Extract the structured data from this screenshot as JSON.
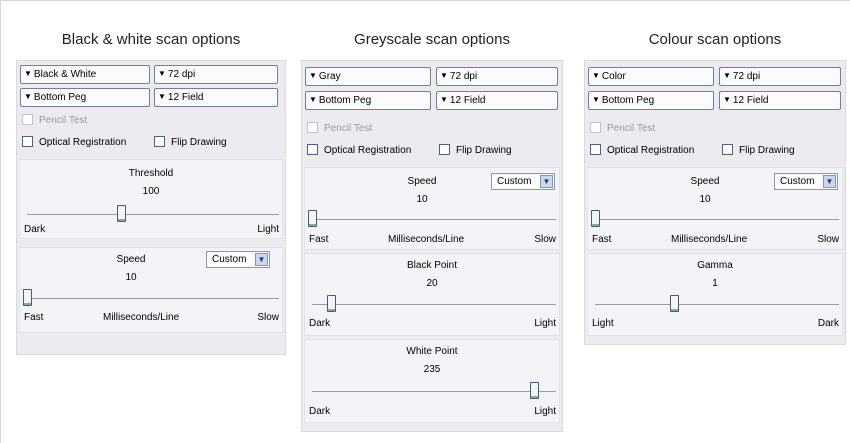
{
  "columns": {
    "bw": {
      "title": "Black & white scan options",
      "mode": "Black & White",
      "resolution": "72 dpi",
      "peg": "Bottom Peg",
      "field": "12 Field",
      "pencil_test": "Pencil Test",
      "optical_registration": "Optical Registration",
      "flip_drawing": "Flip Drawing",
      "threshold": {
        "label": "Threshold",
        "value": "100",
        "low": "Dark",
        "high": "Light",
        "level": 0.41
      },
      "speed": {
        "label": "Speed",
        "value": "10",
        "preset": "Custom",
        "low": "Fast",
        "mid": "Milliseconds/Line",
        "high": "Slow",
        "level": 0.0
      }
    },
    "grey": {
      "title": "Greyscale scan options",
      "mode": "Gray",
      "resolution": "72 dpi",
      "peg": "Bottom Peg",
      "field": "12 Field",
      "pencil_test": "Pencil Test",
      "optical_registration": "Optical Registration",
      "flip_drawing": "Flip Drawing",
      "speed": {
        "label": "Speed",
        "value": "10",
        "preset": "Custom",
        "low": "Fast",
        "mid": "Milliseconds/Line",
        "high": "Slow",
        "level": 0.0
      },
      "black_point": {
        "label": "Black Point",
        "value": "20",
        "low": "Dark",
        "high": "Light",
        "level": 0.08
      },
      "white_point": {
        "label": "White Point",
        "value": "235",
        "low": "Dark",
        "high": "Light",
        "level": 0.92
      }
    },
    "colour": {
      "title": "Colour scan options",
      "mode": "Color",
      "resolution": "72 dpi",
      "peg": "Bottom Peg",
      "field": "12 Field",
      "pencil_test": "Pencil Test",
      "optical_registration": "Optical Registration",
      "flip_drawing": "Flip Drawing",
      "speed": {
        "label": "Speed",
        "value": "10",
        "preset": "Custom",
        "low": "Fast",
        "mid": "Milliseconds/Line",
        "high": "Slow",
        "level": 0.0
      },
      "gamma": {
        "label": "Gamma",
        "value": "1",
        "low": "Light",
        "high": "Dark",
        "level": 0.33
      }
    }
  },
  "icons": {
    "dropdown": "down-triangle-icon",
    "combo": "chevron-down-icon"
  },
  "colors": {
    "panel": "#ebebf0",
    "slider_thumb_border": "#3d5b8c",
    "dropdown_border": "#6c7fa6"
  }
}
